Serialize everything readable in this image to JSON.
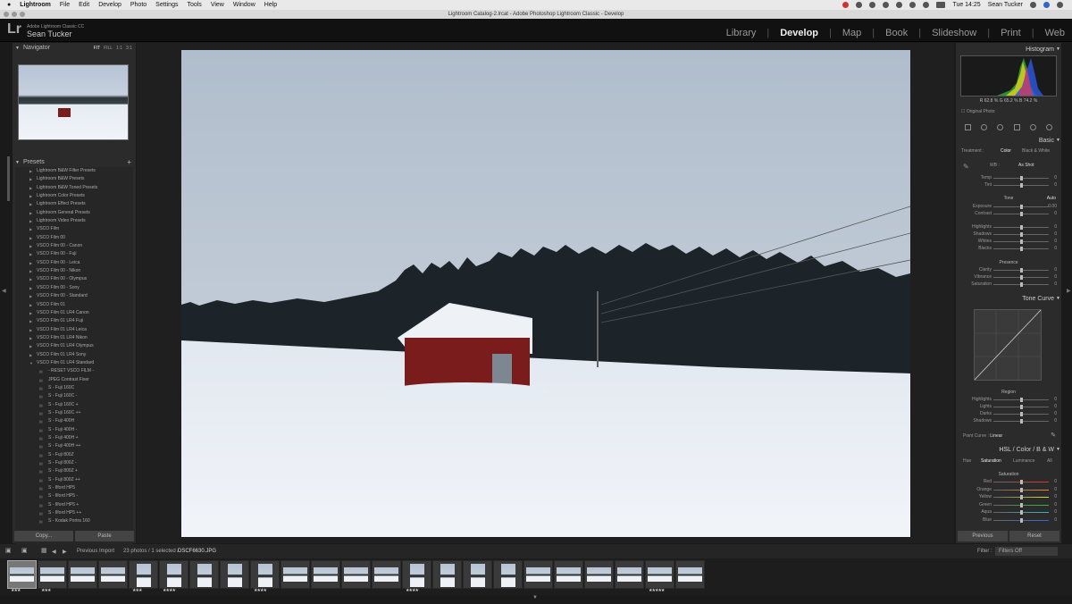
{
  "menubar": {
    "apple": "",
    "app": "Lightroom",
    "items": [
      "File",
      "Edit",
      "Develop",
      "Photo",
      "Settings",
      "Tools",
      "View",
      "Window",
      "Help"
    ],
    "clock": "Tue 14:25",
    "user": "Sean Tucker"
  },
  "window": {
    "title": "Lightroom Catalog-2.lrcat - Adobe Photoshop Lightroom Classic - Develop"
  },
  "identity": {
    "logo": "Lr",
    "sub": "Adobe Lightroom Classic CC",
    "name": "Sean Tucker"
  },
  "modules": [
    "Library",
    "Develop",
    "Map",
    "Book",
    "Slideshow",
    "Print",
    "Web"
  ],
  "active_module": "Develop",
  "navigator": {
    "title": "Navigator",
    "options": [
      "FIT",
      "FILL",
      "1:1",
      "3:1"
    ]
  },
  "presets": {
    "title": "Presets",
    "add": "+",
    "folders": [
      "Lightroom B&W Filter Presets",
      "Lightroom B&W Presets",
      "Lightroom B&W Toned Presets",
      "Lightroom Color Presets",
      "Lightroom Effect Presets",
      "Lightroom General Presets",
      "Lightroom Video Presets",
      "VSCO Film",
      "VSCO Film 00",
      "VSCO Film 00 - Canon",
      "VSCO Film 00 - Fuji",
      "VSCO Film 00 - Leica",
      "VSCO Film 00 - Nikon",
      "VSCO Film 00 - Olympus",
      "VSCO Film 00 - Sony",
      "VSCO Film 00 - Standard",
      "VSCO Film 01",
      "VSCO Film 01 LR4 Canon",
      "VSCO Film 01 LR4 Fuji",
      "VSCO Film 01 LR4 Leica",
      "VSCO Film 01 LR4 Nikon",
      "VSCO Film 01 LR4 Olympus",
      "VSCO Film 01 LR4 Sony",
      "VSCO Film 01 LR4 Standard"
    ],
    "items": [
      "- RESET VSCO FILM -",
      "JPEG Contrast Fixer",
      "S - Fuji 160C",
      "S - Fuji 160C -",
      "S - Fuji 160C +",
      "S - Fuji 160C ++",
      "S - Fuji 400H",
      "S - Fuji 400H -",
      "S - Fuji 400H +",
      "S - Fuji 400H ++",
      "S - Fuji 800Z",
      "S - Fuji 800Z -",
      "S - Fuji 800Z +",
      "S - Fuji 800Z ++",
      "S - Ilford HP5",
      "S - Ilford HP5 -",
      "S - Ilford HP5 +",
      "S - Ilford HP5 ++",
      "S - Kodak Portra 160"
    ],
    "copy": "Copy...",
    "paste": "Paste"
  },
  "histogram": {
    "title": "Histogram",
    "r_label": "R",
    "r": "62.8",
    "g_label": "G",
    "g": "65.2",
    "b_label": "B",
    "b": "74.2",
    "pct": "%",
    "original_photo": "Original Photo"
  },
  "basic": {
    "title": "Basic",
    "treatment_label": "Treatment :",
    "color": "Color",
    "bw": "Black & White",
    "wb_label": "WB :",
    "wb_value": "As Shot",
    "temp": {
      "label": "Temp",
      "value": "0",
      "pos": 0.5
    },
    "tint": {
      "label": "Tint",
      "value": "0",
      "pos": 0.5
    },
    "tone_label": "Tone",
    "auto": "Auto",
    "exposure": {
      "label": "Exposure",
      "value": "0.00",
      "pos": 0.5
    },
    "contrast": {
      "label": "Contrast",
      "value": "0",
      "pos": 0.5
    },
    "highlights": {
      "label": "Highlights",
      "value": "0",
      "pos": 0.5
    },
    "shadows": {
      "label": "Shadows",
      "value": "0",
      "pos": 0.5
    },
    "whites": {
      "label": "Whites",
      "value": "0",
      "pos": 0.5
    },
    "blacks": {
      "label": "Blacks",
      "value": "0",
      "pos": 0.5
    },
    "presence_label": "Presence",
    "clarity": {
      "label": "Clarity",
      "value": "0",
      "pos": 0.5
    },
    "vibrance": {
      "label": "Vibrance",
      "value": "0",
      "pos": 0.5
    },
    "saturation": {
      "label": "Saturation",
      "value": "0",
      "pos": 0.5
    }
  },
  "tone_curve": {
    "title": "Tone Curve",
    "region_label": "Region",
    "highlights": {
      "label": "Highlights",
      "value": "0",
      "pos": 0.5
    },
    "lights": {
      "label": "Lights",
      "value": "0",
      "pos": 0.5
    },
    "darks": {
      "label": "Darks",
      "value": "0",
      "pos": 0.5
    },
    "shadows": {
      "label": "Shadows",
      "value": "0",
      "pos": 0.5
    },
    "point_curve_label": "Point Curve :",
    "point_curve_value": "Linear"
  },
  "hsl": {
    "title": "HSL",
    "sep1": "/",
    "color": "Color",
    "sep2": "/",
    "bw": "B & W",
    "tabs": [
      "Hue",
      "Saturation",
      "Luminance",
      "All"
    ],
    "section": "Saturation",
    "rows": [
      {
        "label": "Red",
        "value": "0"
      },
      {
        "label": "Orange",
        "value": "0"
      },
      {
        "label": "Yellow",
        "value": "0"
      },
      {
        "label": "Green",
        "value": "0"
      },
      {
        "label": "Aqua",
        "value": "0"
      },
      {
        "label": "Blue",
        "value": "0"
      }
    ]
  },
  "right_buttons": {
    "previous": "Previous",
    "reset": "Reset"
  },
  "filmstrip_bar": {
    "source": "Previous Import",
    "count": "23 photos / 1 selected /",
    "filename": "DSCF6630.JPG",
    "filter_label": "Filter :",
    "filter_value": "Filters Off"
  },
  "filmstrip": {
    "thumbs": [
      {
        "orient": "land",
        "stars": "★★★",
        "selected": true
      },
      {
        "orient": "land",
        "stars": "★★★",
        "selected": false
      },
      {
        "orient": "land",
        "stars": "",
        "selected": false
      },
      {
        "orient": "land",
        "stars": "",
        "selected": false
      },
      {
        "orient": "port",
        "stars": "★★★",
        "selected": false
      },
      {
        "orient": "port",
        "stars": "★★★★",
        "selected": false
      },
      {
        "orient": "port",
        "stars": "",
        "selected": false
      },
      {
        "orient": "port",
        "stars": "",
        "selected": false
      },
      {
        "orient": "port",
        "stars": "★★★★",
        "selected": false
      },
      {
        "orient": "land",
        "stars": "",
        "selected": false
      },
      {
        "orient": "land",
        "stars": "",
        "selected": false
      },
      {
        "orient": "land",
        "stars": "",
        "selected": false
      },
      {
        "orient": "land",
        "stars": "",
        "selected": false
      },
      {
        "orient": "port",
        "stars": "★★★★",
        "selected": false
      },
      {
        "orient": "port",
        "stars": "",
        "selected": false
      },
      {
        "orient": "port",
        "stars": "",
        "selected": false
      },
      {
        "orient": "port",
        "stars": "",
        "selected": false
      },
      {
        "orient": "land",
        "stars": "",
        "selected": false
      },
      {
        "orient": "land",
        "stars": "",
        "selected": false
      },
      {
        "orient": "land",
        "stars": "",
        "selected": false
      },
      {
        "orient": "land",
        "stars": "",
        "selected": false
      },
      {
        "orient": "land",
        "stars": "★★★★★",
        "selected": false
      },
      {
        "orient": "land",
        "stars": "",
        "selected": false
      }
    ]
  },
  "colors": {
    "barn": "#7a1c1c",
    "sky": "#c5ced9",
    "snow": "#eef2f8",
    "accent": "#cccccc"
  }
}
